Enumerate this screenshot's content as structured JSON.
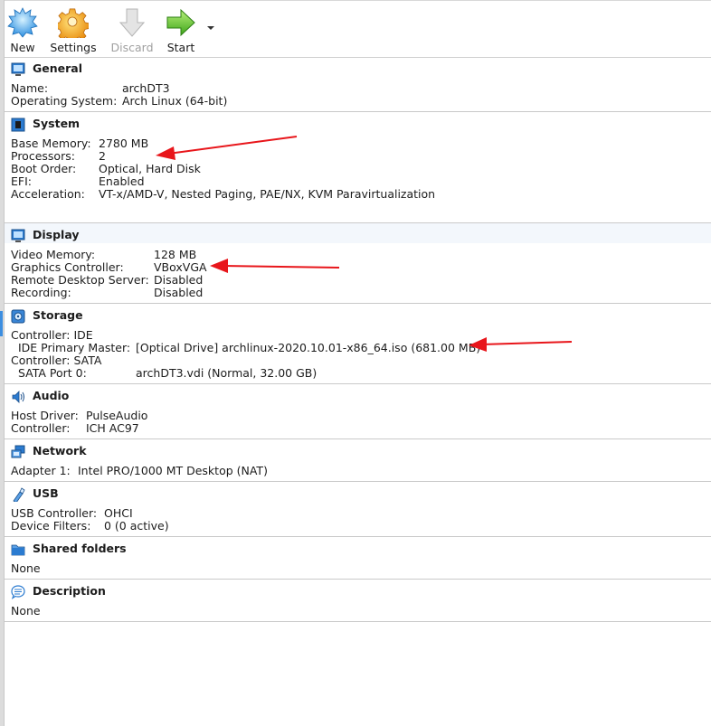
{
  "toolbar": {
    "new_label": "New",
    "settings_label": "Settings",
    "discard_label": "Discard",
    "start_label": "Start"
  },
  "colors": {
    "accent_arrow": "#e8161b",
    "divider": "#c9c9c9",
    "disabled_text": "#a0a0a0"
  },
  "sections": {
    "general": {
      "title": "General",
      "rows": [
        {
          "label": "Name:",
          "value": "archDT3"
        },
        {
          "label": "Operating System:",
          "value": "Arch Linux (64-bit)"
        }
      ]
    },
    "system": {
      "title": "System",
      "rows": [
        {
          "label": "Base Memory:",
          "value": "2780 MB"
        },
        {
          "label": "Processors:",
          "value": "2"
        },
        {
          "label": "Boot Order:",
          "value": "Optical, Hard Disk"
        },
        {
          "label": "EFI:",
          "value": "Enabled"
        },
        {
          "label": "Acceleration:",
          "value": "VT-x/AMD-V, Nested Paging, PAE/NX, KVM Paravirtualization"
        }
      ]
    },
    "display": {
      "title": "Display",
      "rows": [
        {
          "label": "Video Memory:",
          "value": "128 MB"
        },
        {
          "label": "Graphics Controller:",
          "value": "VBoxVGA"
        },
        {
          "label": "Remote Desktop Server:",
          "value": "Disabled"
        },
        {
          "label": "Recording:",
          "value": "Disabled"
        }
      ]
    },
    "storage": {
      "title": "Storage",
      "rows": [
        {
          "label": "Controller: IDE",
          "value": ""
        },
        {
          "label": "  IDE Primary Master:",
          "value": "[Optical Drive] archlinux-2020.10.01-x86_64.iso (681.00 MB)"
        },
        {
          "label": "Controller: SATA",
          "value": ""
        },
        {
          "label": "  SATA Port 0:",
          "value": "archDT3.vdi (Normal, 32.00 GB)"
        }
      ]
    },
    "audio": {
      "title": "Audio",
      "rows": [
        {
          "label": "Host Driver:",
          "value": "PulseAudio"
        },
        {
          "label": "Controller:",
          "value": "ICH AC97"
        }
      ]
    },
    "network": {
      "title": "Network",
      "rows": [
        {
          "label": "Adapter 1:",
          "value": "Intel PRO/1000 MT Desktop (NAT)"
        }
      ]
    },
    "usb": {
      "title": "USB",
      "rows": [
        {
          "label": "USB Controller:",
          "value": "OHCI"
        },
        {
          "label": "Device Filters:",
          "value": "0 (0 active)"
        }
      ]
    },
    "shared_folders": {
      "title": "Shared folders",
      "rows": [
        {
          "label": "None",
          "value": ""
        }
      ]
    },
    "description": {
      "title": "Description",
      "rows": [
        {
          "label": "None",
          "value": ""
        }
      ]
    }
  }
}
